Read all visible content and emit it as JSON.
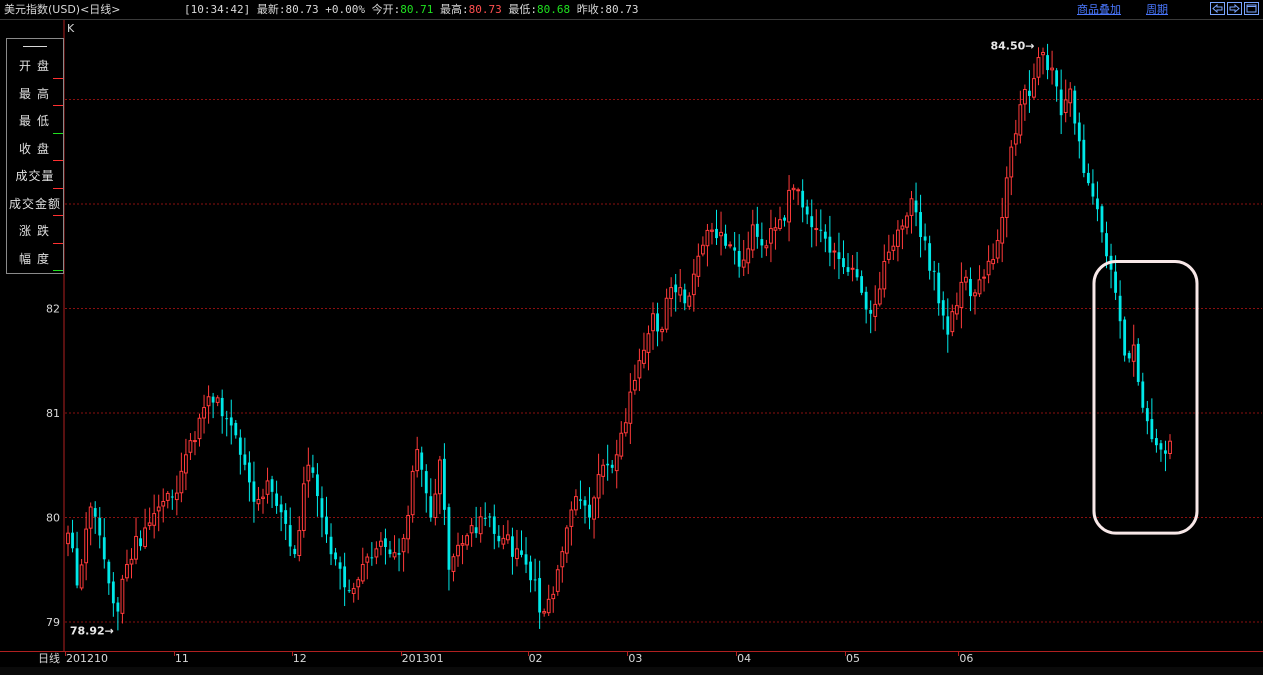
{
  "header": {
    "title": "美元指数(USD)<日线>",
    "time": "[10:34:42]",
    "latest_label": "最新:",
    "latest_value": "80.73",
    "change": "+0.00%",
    "open_label": "今开:",
    "open_value": "80.71",
    "high_label": "最高:",
    "high_value": "80.73",
    "low_label": "最低:",
    "low_value": "80.68",
    "prev_close_label": "昨收:",
    "prev_close_value": "80.73",
    "overlay_link": "商品叠加",
    "period_link": "周期"
  },
  "window_buttons": [
    "arrow-left-icon",
    "arrow-right-icon",
    "maximize-icon"
  ],
  "side_menu": {
    "items": [
      {
        "label": "开盘",
        "mark": "red"
      },
      {
        "label": "最高",
        "mark": "red"
      },
      {
        "label": "最低",
        "mark": "green"
      },
      {
        "label": "收盘",
        "mark": "red"
      },
      {
        "label": "成交量",
        "mark": "red"
      },
      {
        "label": "成交金额",
        "mark": "red"
      },
      {
        "label": "涨跌",
        "mark": "red"
      },
      {
        "label": "幅度",
        "mark": "green"
      }
    ]
  },
  "chart_label": "K",
  "period_label": "日线",
  "colors": {
    "up": "#ff3a3a",
    "down": "#00e8e8",
    "grid": "#8a1010",
    "highlight_box": "#f8e8e8"
  },
  "chart_data": {
    "type": "candlestick",
    "ylim": [
      78.85,
      84.9
    ],
    "y_ticks": [
      79,
      80,
      81,
      82
    ],
    "x_ticks": [
      "201210",
      "11",
      "12",
      "201301",
      "02",
      "03",
      "04",
      "05",
      "06"
    ],
    "max_annotation": "84.50",
    "min_annotation": "78.92",
    "anchors": [
      [
        0,
        79.85
      ],
      [
        2,
        79.35
      ],
      [
        5,
        80.1
      ],
      [
        8,
        79.6
      ],
      [
        11,
        79.1
      ],
      [
        13,
        79.55
      ],
      [
        17,
        79.9
      ],
      [
        20,
        80.1
      ],
      [
        23,
        80.2
      ],
      [
        26,
        80.6
      ],
      [
        29,
        80.95
      ],
      [
        32,
        81.1
      ],
      [
        35,
        80.95
      ],
      [
        38,
        80.6
      ],
      [
        41,
        80.15
      ],
      [
        44,
        80.35
      ],
      [
        47,
        80.05
      ],
      [
        50,
        79.65
      ],
      [
        53,
        80.5
      ],
      [
        56,
        80.0
      ],
      [
        59,
        79.6
      ],
      [
        62,
        79.3
      ],
      [
        65,
        79.55
      ],
      [
        68,
        79.7
      ],
      [
        71,
        79.65
      ],
      [
        74,
        79.8
      ],
      [
        77,
        80.65
      ],
      [
        80,
        80.0
      ],
      [
        82,
        80.55
      ],
      [
        84,
        79.5
      ],
      [
        87,
        79.75
      ],
      [
        90,
        79.85
      ],
      [
        93,
        80.0
      ],
      [
        96,
        79.8
      ],
      [
        99,
        79.7
      ],
      [
        102,
        79.4
      ],
      [
        105,
        79.1
      ],
      [
        108,
        79.5
      ],
      [
        110,
        79.9
      ],
      [
        112,
        80.2
      ],
      [
        115,
        80.0
      ],
      [
        118,
        80.5
      ],
      [
        121,
        80.6
      ],
      [
        124,
        81.2
      ],
      [
        127,
        81.6
      ],
      [
        129,
        81.95
      ],
      [
        131,
        81.8
      ],
      [
        133,
        82.2
      ],
      [
        136,
        82.05
      ],
      [
        139,
        82.5
      ],
      [
        142,
        82.75
      ],
      [
        145,
        82.6
      ],
      [
        148,
        82.4
      ],
      [
        151,
        82.8
      ],
      [
        154,
        82.6
      ],
      [
        157,
        82.85
      ],
      [
        160,
        83.15
      ],
      [
        163,
        82.9
      ],
      [
        166,
        82.75
      ],
      [
        169,
        82.55
      ],
      [
        172,
        82.35
      ],
      [
        175,
        82.15
      ],
      [
        177,
        81.95
      ],
      [
        180,
        82.45
      ],
      [
        183,
        82.75
      ],
      [
        186,
        83.05
      ],
      [
        189,
        82.65
      ],
      [
        192,
        82.05
      ],
      [
        194,
        81.75
      ],
      [
        197,
        82.25
      ],
      [
        200,
        82.15
      ],
      [
        202,
        82.3
      ],
      [
        205,
        82.65
      ],
      [
        207,
        83.25
      ],
      [
        210,
        83.95
      ],
      [
        213,
        84.2
      ],
      [
        215,
        84.45
      ],
      [
        217,
        84.3
      ],
      [
        219,
        83.85
      ],
      [
        221,
        84.1
      ],
      [
        223,
        83.6
      ],
      [
        225,
        83.2
      ],
      [
        227,
        82.95
      ],
      [
        229,
        82.5
      ],
      [
        231,
        82.15
      ],
      [
        233,
        81.55
      ],
      [
        235,
        81.65
      ],
      [
        237,
        81.05
      ],
      [
        239,
        80.75
      ],
      [
        241,
        80.65
      ],
      [
        243,
        80.73
      ]
    ],
    "highlight_box_range": {
      "x_from_index": 228,
      "x_to_index": 243,
      "y_from": 79.85,
      "y_to": 82.45
    }
  }
}
